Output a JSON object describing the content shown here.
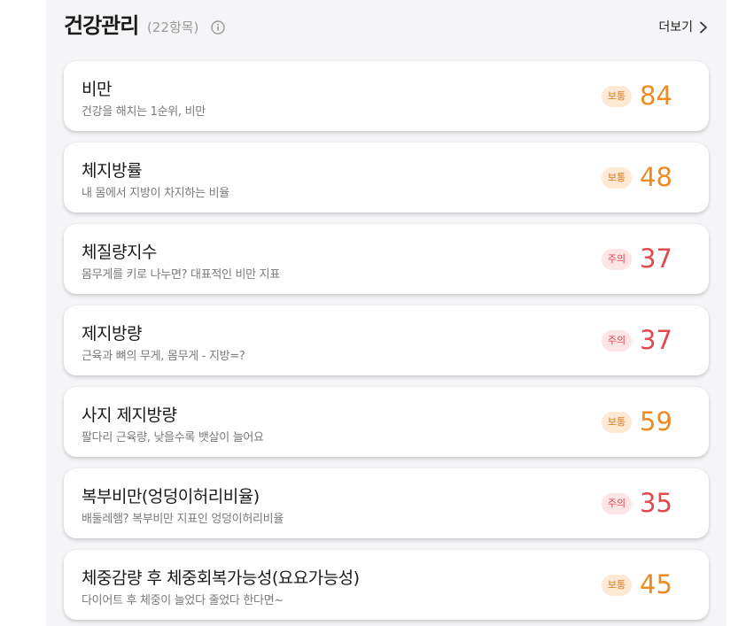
{
  "header": {
    "title": "건강관리",
    "count": "(22항목)",
    "more_label": "더보기"
  },
  "colors": {
    "normal": "#ee8a1f",
    "caution": "#e04a4f",
    "normal_badge_bg": "#ffe8d4",
    "caution_badge_bg": "#fde5e6"
  },
  "items": [
    {
      "title": "비만",
      "subtitle": "건강을 해치는 1순위, 비만",
      "badge": "보통",
      "status": "normal",
      "score": "84"
    },
    {
      "title": "체지방률",
      "subtitle": "내 몸에서 지방이 차지하는 비율",
      "badge": "보통",
      "status": "normal",
      "score": "48"
    },
    {
      "title": "체질량지수",
      "subtitle": "몸무게를 키로 나누면? 대표적인 비만 지표",
      "badge": "주의",
      "status": "caution",
      "score": "37"
    },
    {
      "title": "제지방량",
      "subtitle": "근육과 뼈의 무게, 몸무게 - 지방=?",
      "badge": "주의",
      "status": "caution",
      "score": "37"
    },
    {
      "title": "사지 제지방량",
      "subtitle": "팔다리 근육량, 낮을수록 뱃살이 늘어요",
      "badge": "보통",
      "status": "normal",
      "score": "59"
    },
    {
      "title": "복부비만(엉덩이허리비율)",
      "subtitle": "배둘레햄? 복부비만 지표인 엉덩이허리비율",
      "badge": "주의",
      "status": "caution",
      "score": "35"
    },
    {
      "title": "체중감량 후 체중회복가능성(요요가능성)",
      "subtitle": "다이어트 후 체중이 늘었다 줄었다 한다면~",
      "badge": "보통",
      "status": "normal",
      "score": "45"
    }
  ]
}
